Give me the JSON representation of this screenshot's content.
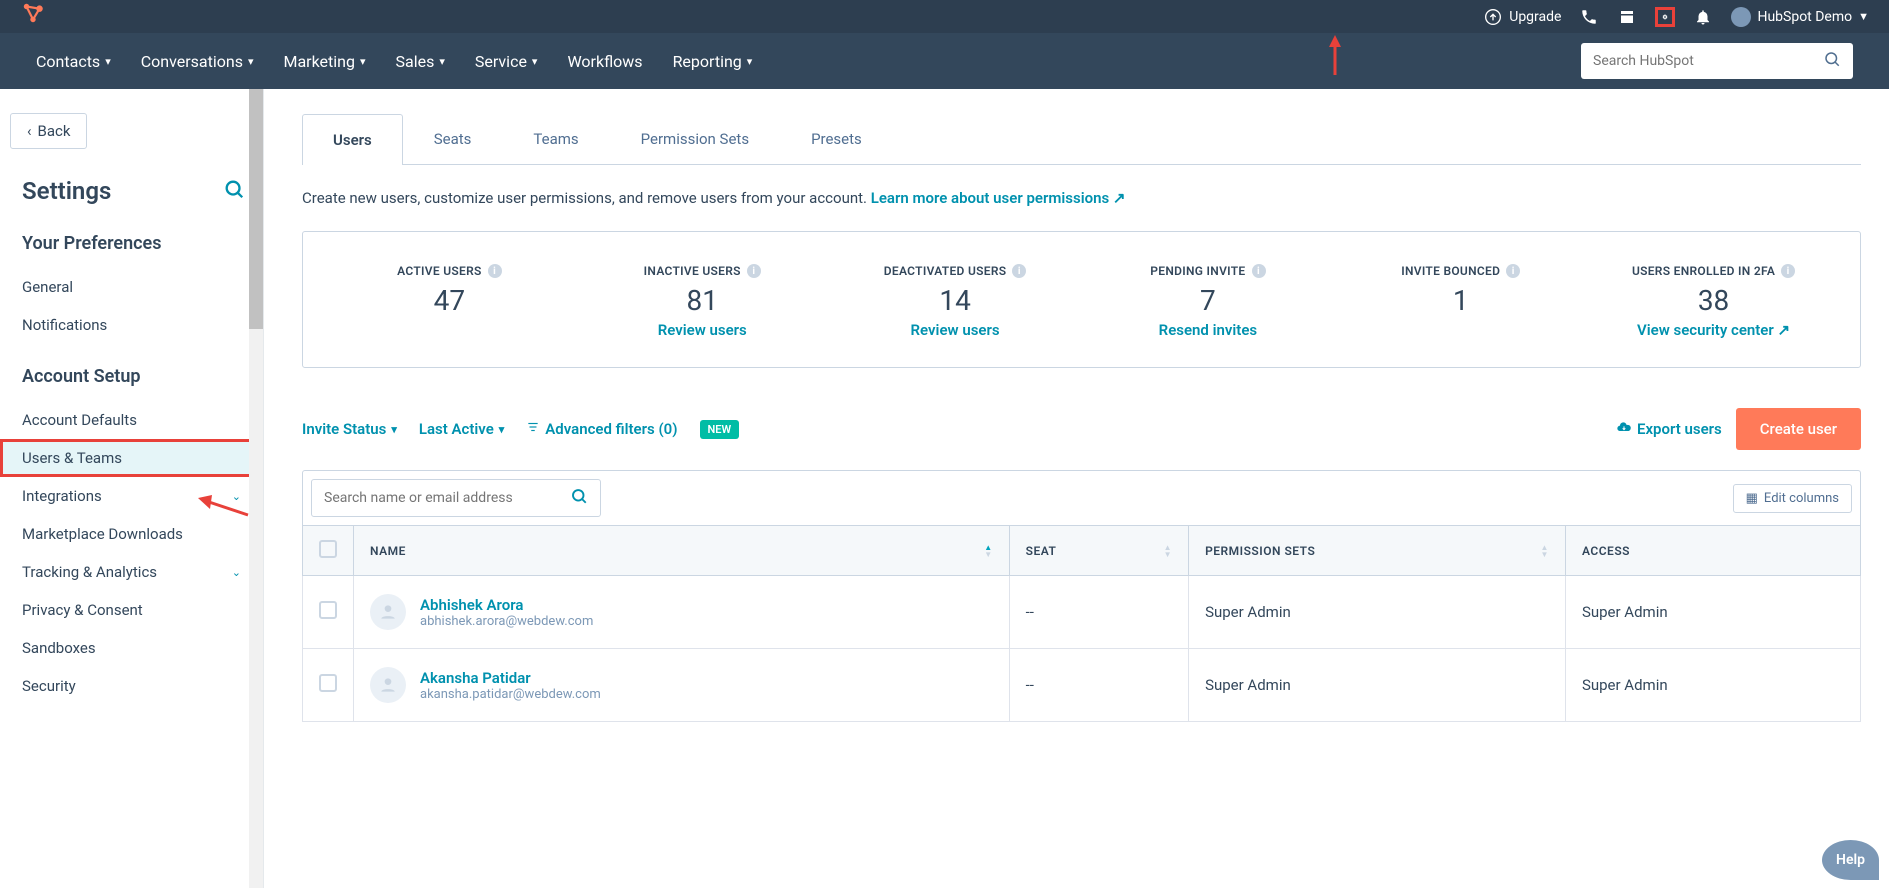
{
  "topbar": {
    "upgrade": "Upgrade",
    "account": "HubSpot Demo"
  },
  "nav": {
    "items": [
      "Contacts",
      "Conversations",
      "Marketing",
      "Sales",
      "Service",
      "Workflows",
      "Reporting"
    ],
    "search_placeholder": "Search HubSpot"
  },
  "sidebar": {
    "back": "Back",
    "title": "Settings",
    "section1": "Your Preferences",
    "prefs": [
      "General",
      "Notifications"
    ],
    "section2": "Account Setup",
    "account": [
      "Account Defaults",
      "Users & Teams",
      "Integrations",
      "Marketplace Downloads",
      "Tracking & Analytics",
      "Privacy & Consent",
      "Sandboxes",
      "Security"
    ]
  },
  "tabs": [
    "Users",
    "Seats",
    "Teams",
    "Permission Sets",
    "Presets"
  ],
  "intro": {
    "text": "Create new users, customize user permissions, and remove users from your account. ",
    "link": "Learn more about user permissions"
  },
  "stats": {
    "active": {
      "label": "ACTIVE USERS",
      "value": "47"
    },
    "inactive": {
      "label": "INACTIVE USERS",
      "value": "81",
      "link": "Review users"
    },
    "deactivated": {
      "label": "DEACTIVATED USERS",
      "value": "14",
      "link": "Review users"
    },
    "pending": {
      "label": "PENDING INVITE",
      "value": "7",
      "link": "Resend invites"
    },
    "bounced": {
      "label": "INVITE BOUNCED",
      "value": "1"
    },
    "twofa": {
      "label": "USERS ENROLLED IN 2FA",
      "value": "38",
      "link": "View security center"
    }
  },
  "filters": {
    "invite_status": "Invite Status",
    "last_active": "Last Active",
    "advanced": "Advanced filters (0)",
    "new_badge": "NEW",
    "export": "Export users",
    "create": "Create user"
  },
  "table": {
    "search_placeholder": "Search name or email address",
    "edit_cols": "Edit columns",
    "cols": {
      "name": "NAME",
      "seat": "SEAT",
      "perm": "PERMISSION SETS",
      "access": "ACCESS"
    },
    "rows": [
      {
        "name": "Abhishek Arora",
        "email": "abhishek.arora@webdew.com",
        "seat": "--",
        "perm": "Super Admin",
        "access": "Super Admin"
      },
      {
        "name": "Akansha Patidar",
        "email": "akansha.patidar@webdew.com",
        "seat": "--",
        "perm": "Super Admin",
        "access": "Super Admin"
      }
    ]
  },
  "help": "Help"
}
